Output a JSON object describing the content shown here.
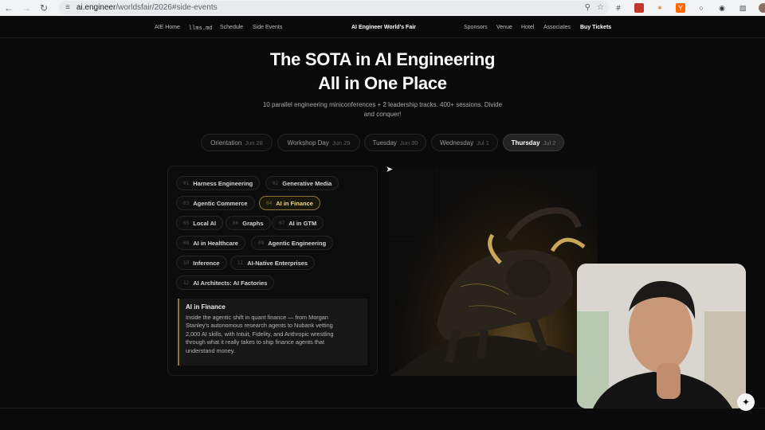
{
  "browser": {
    "url_host": "ai.engineer",
    "url_path": "/worldsfair/2026#side-events"
  },
  "nav": {
    "left": [
      "AIE Home",
      "llms.md",
      "Schedule",
      "Side Events"
    ],
    "brand": "AI Engineer World's Fair",
    "right": [
      "Sponsors",
      "Venue",
      "Hotel",
      "Associates"
    ],
    "cta": "Buy Tickets"
  },
  "hero": {
    "title_line1": "The SOTA in AI Engineering",
    "title_line2": "All in One Place",
    "subtitle_line1": "10 parallel engineering miniconferences + 2 leadership tracks. 400+ sessions. Divide",
    "subtitle_line2": "and conquer!"
  },
  "days": [
    {
      "name": "Orientation",
      "date": "Jun 28"
    },
    {
      "name": "Workshop Day",
      "date": "Jun 29"
    },
    {
      "name": "Tuesday",
      "date": "Jun 30"
    },
    {
      "name": "Wednesday",
      "date": "Jul 1"
    },
    {
      "name": "Thursday",
      "date": "Jul 2"
    }
  ],
  "active_day": "Thursday",
  "tracks": [
    {
      "num": "01",
      "label": "Harness Engineering"
    },
    {
      "num": "02",
      "label": "Generative Media"
    },
    {
      "num": "03",
      "label": "Agentic Commerce"
    },
    {
      "num": "04",
      "label": "AI in Finance"
    },
    {
      "num": "05",
      "label": "Local AI"
    },
    {
      "num": "06",
      "label": "Graphs"
    },
    {
      "num": "07",
      "label": "AI in GTM"
    },
    {
      "num": "08",
      "label": "AI in Healthcare"
    },
    {
      "num": "09",
      "label": "Agentic Engineering"
    },
    {
      "num": "10",
      "label": "Inference"
    },
    {
      "num": "11",
      "label": "AI-Native Enterprises"
    },
    {
      "num": "12",
      "label": "AI Architects: AI Factories"
    }
  ],
  "active_track": "AI in Finance",
  "description": {
    "title": "AI in Finance",
    "line1": "Inside the agentic shift in quant finance — from Morgan",
    "line2": "Stanley's autonomous research agents to Nubank vetting",
    "line3": "2,000 AI skills, with Intuit, Fidelity, and Anthropic wrestling",
    "line4": "through what it really takes to ship finance agents that",
    "line5": "understand money."
  },
  "colors": {
    "accent": "#f3d98a",
    "background": "#0a0a0a"
  },
  "icons": {
    "fab": "sparkle-icon"
  }
}
